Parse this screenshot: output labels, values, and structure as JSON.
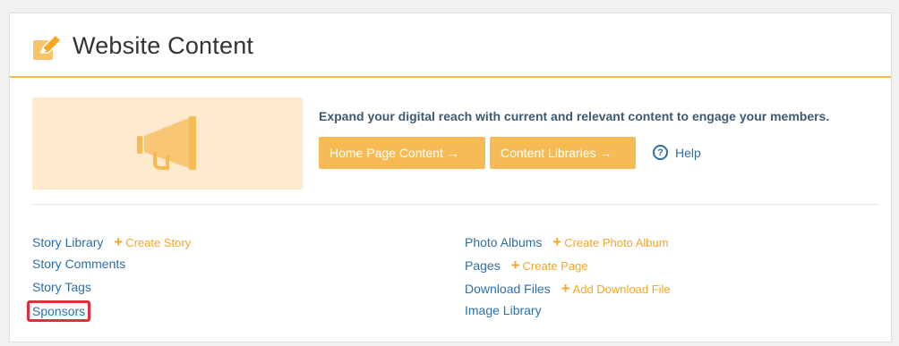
{
  "panel": {
    "title": "Website Content",
    "icon": "pencil-edit-icon"
  },
  "intro": {
    "tagline": "Expand your digital reach with current and relevant content to engage your members.",
    "home_button": "Home Page Content →",
    "libraries_button": "Content Libraries →",
    "help_label": "Help",
    "hero_icon": "megaphone-icon"
  },
  "links": {
    "left": [
      {
        "label": "Story Library",
        "action": "Create Story"
      },
      {
        "label": "Story Comments"
      },
      {
        "label": "Story Tags"
      },
      {
        "label": "Sponsors",
        "highlighted": true
      }
    ],
    "right": [
      {
        "label": "Photo Albums",
        "action": "Create Photo Album"
      },
      {
        "label": "Pages",
        "action": "Create Page"
      },
      {
        "label": "Download Files",
        "action": "Add Download File"
      },
      {
        "label": "Image Library"
      }
    ]
  },
  "colors": {
    "accent": "#f7bb55",
    "link": "#2e6ea6",
    "highlight_border": "#e0303b"
  }
}
